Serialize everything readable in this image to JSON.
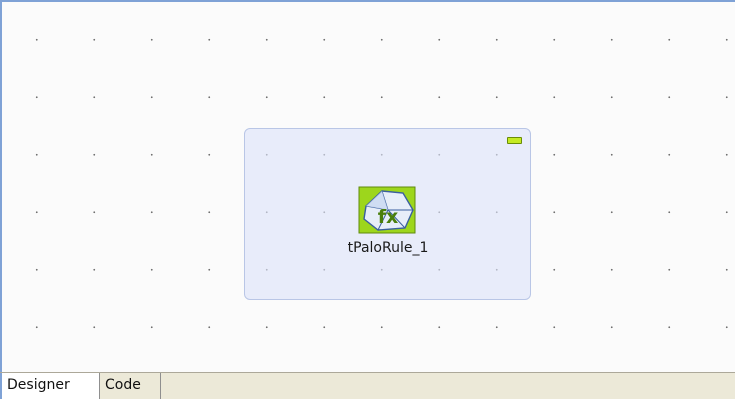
{
  "colors": {
    "canvas_background": "#fbfbfb",
    "grid_dot": "#6f6f6f",
    "subjob_fill": "#dce2f8",
    "subjob_border": "#b9c6e6",
    "collapse_toggle": "#c5ea22",
    "tabbar_background": "#ece9d8",
    "frame_accent": "#7fa2d6"
  },
  "canvas": {
    "subjob": {
      "collapse_icon": "minimize-icon",
      "component": {
        "label": "tPaloRule_1",
        "icon": "palo-rule-fx-icon",
        "icon_text": "fx"
      }
    }
  },
  "tabs": [
    {
      "label": "Designer",
      "active": true
    },
    {
      "label": "Code",
      "active": false
    }
  ]
}
